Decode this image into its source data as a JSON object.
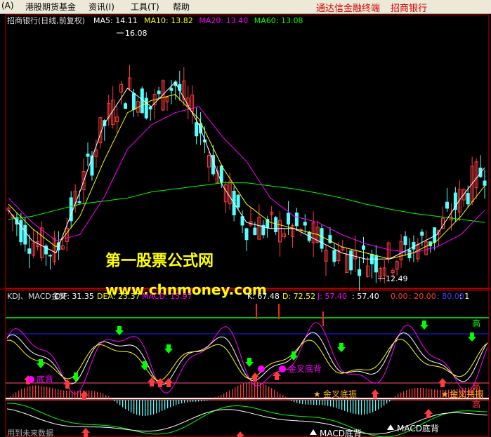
{
  "menubar": {
    "items": [
      "(A)",
      "港股期货基金",
      "资讯(I)",
      "工具(T)",
      "帮助"
    ],
    "brand_left": "通达信金融终端",
    "brand_right": "招商银行"
  },
  "colors": {
    "background": "#000000",
    "up_candle": "#ff3b3b",
    "down_candle": "#54ffff",
    "ma5": "#ffffff",
    "ma10": "#ffff00",
    "ma20": "#ff00ff",
    "ma60": "#00ff00",
    "frame": "#c00000",
    "watermark": "#ffff00"
  },
  "chart_data": [
    {
      "type": "candlestick",
      "title": "招商银行(日线,前复权)",
      "indicators": [
        {
          "label": "MA5: 14.11",
          "color": "#ffffff"
        },
        {
          "label": "MA10: 13.82",
          "color": "#ffff00"
        },
        {
          "label": "MA20: 13.40",
          "color": "#ff00ff"
        },
        {
          "label": "MA60: 13.08",
          "color": "#00ff00"
        }
      ],
      "ylim": [
        12.2,
        16.4
      ],
      "max_label": "16.08",
      "min_label": "12.49",
      "max_value": 16.08,
      "min_value": 12.49,
      "ma60": [
        13.25,
        13.3,
        13.4,
        13.5,
        13.55,
        13.6,
        13.7,
        13.75,
        13.8,
        13.85,
        13.85,
        13.8,
        13.75,
        13.68,
        13.6,
        13.5,
        13.42,
        13.35,
        13.3,
        13.25,
        13.2
      ],
      "ma20": [
        13.6,
        13.2,
        12.9,
        13.0,
        13.6,
        14.4,
        14.8,
        15.0,
        15.1,
        14.6,
        14.2,
        13.6,
        13.3,
        13.2,
        13.0,
        12.85,
        12.75,
        12.7,
        12.8,
        13.0,
        13.4
      ],
      "ma10": [
        13.5,
        13.1,
        12.8,
        13.3,
        14.2,
        15.0,
        15.2,
        15.3,
        14.9,
        14.1,
        13.5,
        13.2,
        13.1,
        13.0,
        12.8,
        12.7,
        12.6,
        12.7,
        12.9,
        13.3,
        13.8
      ],
      "ma5": [
        13.4,
        12.9,
        12.7,
        13.7,
        14.8,
        15.4,
        15.1,
        15.5,
        14.8,
        13.8,
        13.2,
        13.1,
        13.1,
        12.9,
        12.7,
        12.6,
        12.6,
        12.8,
        13.0,
        13.6,
        14.1
      ]
    },
    {
      "type": "line",
      "title": "KDJ、MACD金叉",
      "indicators": [
        {
          "label": "DIF: 31.35",
          "color": "#ffffff"
        },
        {
          "label": "DEA: 23.37",
          "color": "#ffff00"
        },
        {
          "label": "MACD: 15.97",
          "color": "#ff00ff"
        },
        {
          "label": "K: 67.48",
          "color": "#ffffff"
        },
        {
          "label": "D: 72.52",
          "color": "#ffff00"
        },
        {
          "label": "J: 57.40",
          "color": "#ff00ff"
        },
        {
          "label": ": 57.40",
          "color": "#ffffff"
        },
        {
          "label": "0.00",
          "color": "#ff3b3b"
        },
        {
          "label": ": 20.00",
          "color": "#ff3b3b"
        },
        {
          "label": ": 80.00",
          "color": "#4040ff"
        },
        {
          "label": ": 1",
          "color": "#ffffff"
        }
      ],
      "levels": [
        {
          "label": "高",
          "value": 100
        },
        {
          "label": "高",
          "value": 80
        },
        {
          "label": "高",
          "value": 20
        }
      ],
      "annotations": [
        "底背",
        "金叉底背",
        "金叉底振",
        "MACD底背",
        "MACD底背",
        "金叉共振"
      ],
      "footer": "用到未来数据"
    }
  ],
  "watermark": {
    "line1": "第一股票公式网",
    "line2": "www.chnmoney.com"
  }
}
